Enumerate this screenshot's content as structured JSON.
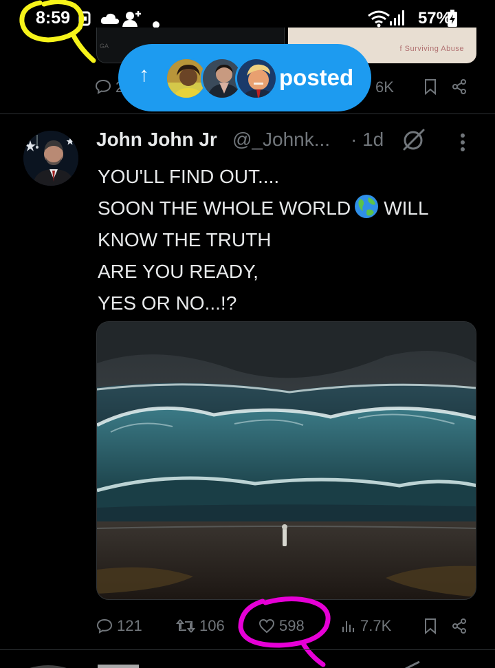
{
  "status_bar": {
    "time": "8:59",
    "battery": "57%",
    "icons": [
      "screenshot-icon",
      "cloud-icon",
      "add-person-icon",
      "dot-icon",
      "wifi-icon",
      "signal-icon",
      "battery-charging-icon"
    ]
  },
  "previous_tweet": {
    "card_left_text": "GA",
    "card_right_text": "f Surviving Abuse",
    "views": "6K",
    "reply_count": "2"
  },
  "posted_pill": {
    "label": "posted",
    "arrow": "↑"
  },
  "tweet": {
    "author_name": "John John Jr",
    "handle": "@_Johnk...",
    "time": "· 1d",
    "lines": [
      "YOU'LL FIND OUT....",
      "SOON THE WHOLE WORLD",
      "WILL",
      "KNOW THE TRUTH",
      "ARE YOU READY,",
      "YES OR NO...!?"
    ],
    "media_description_icon": "ocean-waves-image",
    "replies": "121",
    "reposts": "106",
    "likes": "598",
    "views": "7.7K"
  },
  "annotations": {
    "yellow": "#f6f31a",
    "magenta": "#e600d6"
  },
  "colors": {
    "accent": "#1d9bf0",
    "muted": "#71767b",
    "text": "#e7e9ea",
    "background": "#000000"
  }
}
